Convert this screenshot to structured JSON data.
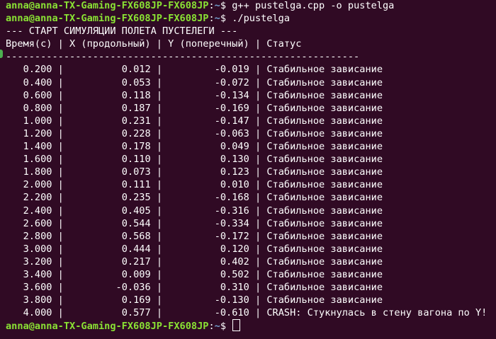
{
  "prompt": {
    "user": "anna@anna-TX-Gaming-FX608JP-FX608JP",
    "path": "~",
    "symbol": "$"
  },
  "commands": [
    "g++ pustelga.cpp -o pustelga",
    "./pustelga"
  ],
  "output": {
    "banner": "--- СТАРТ СИМУЛЯЦИИ ПОЛЕТА ПУСТЕЛЕГИ ---",
    "header": "Время(с) | X (продольный) | Y (поперечный) | Статус",
    "separator": "-------------------------------------------------------------",
    "rows": [
      {
        "t": "0.200",
        "x": "0.012",
        "y": "-0.019",
        "status": "Стабильное зависание"
      },
      {
        "t": "0.400",
        "x": "0.053",
        "y": "-0.072",
        "status": "Стабильное зависание"
      },
      {
        "t": "0.600",
        "x": "0.118",
        "y": "-0.134",
        "status": "Стабильное зависание"
      },
      {
        "t": "0.800",
        "x": "0.187",
        "y": "-0.169",
        "status": "Стабильное зависание"
      },
      {
        "t": "1.000",
        "x": "0.231",
        "y": "-0.147",
        "status": "Стабильное зависание"
      },
      {
        "t": "1.200",
        "x": "0.228",
        "y": "-0.063",
        "status": "Стабильное зависание"
      },
      {
        "t": "1.400",
        "x": "0.178",
        "y": "0.049",
        "status": "Стабильное зависание"
      },
      {
        "t": "1.600",
        "x": "0.110",
        "y": "0.130",
        "status": "Стабильное зависание"
      },
      {
        "t": "1.800",
        "x": "0.073",
        "y": "0.123",
        "status": "Стабильное зависание"
      },
      {
        "t": "2.000",
        "x": "0.111",
        "y": "0.010",
        "status": "Стабильное зависание"
      },
      {
        "t": "2.200",
        "x": "0.235",
        "y": "-0.168",
        "status": "Стабильное зависание"
      },
      {
        "t": "2.400",
        "x": "0.405",
        "y": "-0.316",
        "status": "Стабильное зависание"
      },
      {
        "t": "2.600",
        "x": "0.544",
        "y": "-0.334",
        "status": "Стабильное зависание"
      },
      {
        "t": "2.800",
        "x": "0.568",
        "y": "-0.172",
        "status": "Стабильное зависание"
      },
      {
        "t": "3.000",
        "x": "0.444",
        "y": "0.120",
        "status": "Стабильное зависание"
      },
      {
        "t": "3.200",
        "x": "0.217",
        "y": "0.402",
        "status": "Стабильное зависание"
      },
      {
        "t": "3.400",
        "x": "0.009",
        "y": "0.502",
        "status": "Стабильное зависание"
      },
      {
        "t": "3.600",
        "x": "-0.036",
        "y": "0.310",
        "status": "Стабильное зависание"
      },
      {
        "t": "3.800",
        "x": "0.169",
        "y": "-0.130",
        "status": "Стабильное зависание"
      },
      {
        "t": "4.000",
        "x": "0.577",
        "y": "-0.610",
        "status": "CRASH: Стукнулась в стену вагона по Y!"
      }
    ]
  },
  "colors": {
    "background": "#300a24",
    "prompt_user": "#8ae234",
    "prompt_path": "#729fcf",
    "text": "#ffffff"
  }
}
